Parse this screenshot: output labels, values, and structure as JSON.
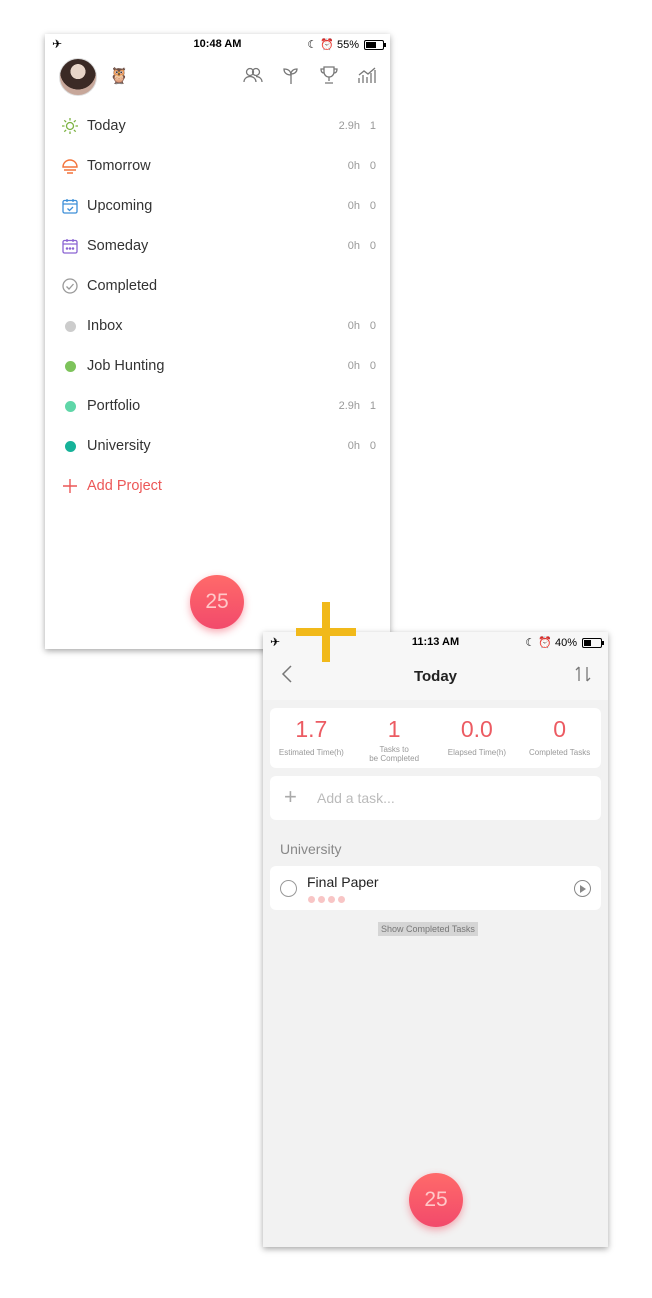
{
  "screen1": {
    "status": {
      "time": "10:48 AM",
      "battery": "55%",
      "battery_level": 0.55
    },
    "header_icons": [
      "friends-icon",
      "sprout-icon",
      "trophy-icon",
      "stats-icon"
    ],
    "items": [
      {
        "label": "Today",
        "hours": "2.9h",
        "count": "1",
        "icon": "sun-icon",
        "color": "#7cb342"
      },
      {
        "label": "Tomorrow",
        "hours": "0h",
        "count": "0",
        "icon": "sunset-icon",
        "color": "#f4743b"
      },
      {
        "label": "Upcoming",
        "hours": "0h",
        "count": "0",
        "icon": "calendar-check-icon",
        "color": "#3d8fd8"
      },
      {
        "label": "Someday",
        "hours": "0h",
        "count": "0",
        "icon": "calendar-grid-icon",
        "color": "#8a63d2"
      },
      {
        "label": "Completed",
        "hours": "",
        "count": "",
        "icon": "check-circle-icon",
        "color": "#999999"
      },
      {
        "label": "Inbox",
        "hours": "0h",
        "count": "0",
        "icon": "dot-icon",
        "color": "#cccccc"
      },
      {
        "label": "Job Hunting",
        "hours": "0h",
        "count": "0",
        "icon": "dot-icon",
        "color": "#7dc35b"
      },
      {
        "label": "Portfolio",
        "hours": "2.9h",
        "count": "1",
        "icon": "dot-icon",
        "color": "#5fd6a8"
      },
      {
        "label": "University",
        "hours": "0h",
        "count": "0",
        "icon": "dot-icon",
        "color": "#16b299"
      }
    ],
    "add_project": "Add Project",
    "timer": "25"
  },
  "screen2": {
    "status": {
      "time": "11:13 AM",
      "battery": "40%",
      "battery_level": 0.4
    },
    "title": "Today",
    "stats": [
      {
        "value": "1.7",
        "label": "Estimated Time(h)"
      },
      {
        "value": "1",
        "label_line1": "Tasks to",
        "label_line2": "be Completed"
      },
      {
        "value": "0.0",
        "label": "Elapsed Time(h)"
      },
      {
        "value": "0",
        "label": "Completed Tasks"
      }
    ],
    "add_task_placeholder": "Add a task...",
    "section": "University",
    "task": {
      "name": "Final Paper",
      "pomodoros": 4
    },
    "show_completed": "Show Completed Tasks",
    "timer": "25"
  },
  "colors": {
    "accent": "#ec5b62",
    "plus": "#f1b91a"
  }
}
